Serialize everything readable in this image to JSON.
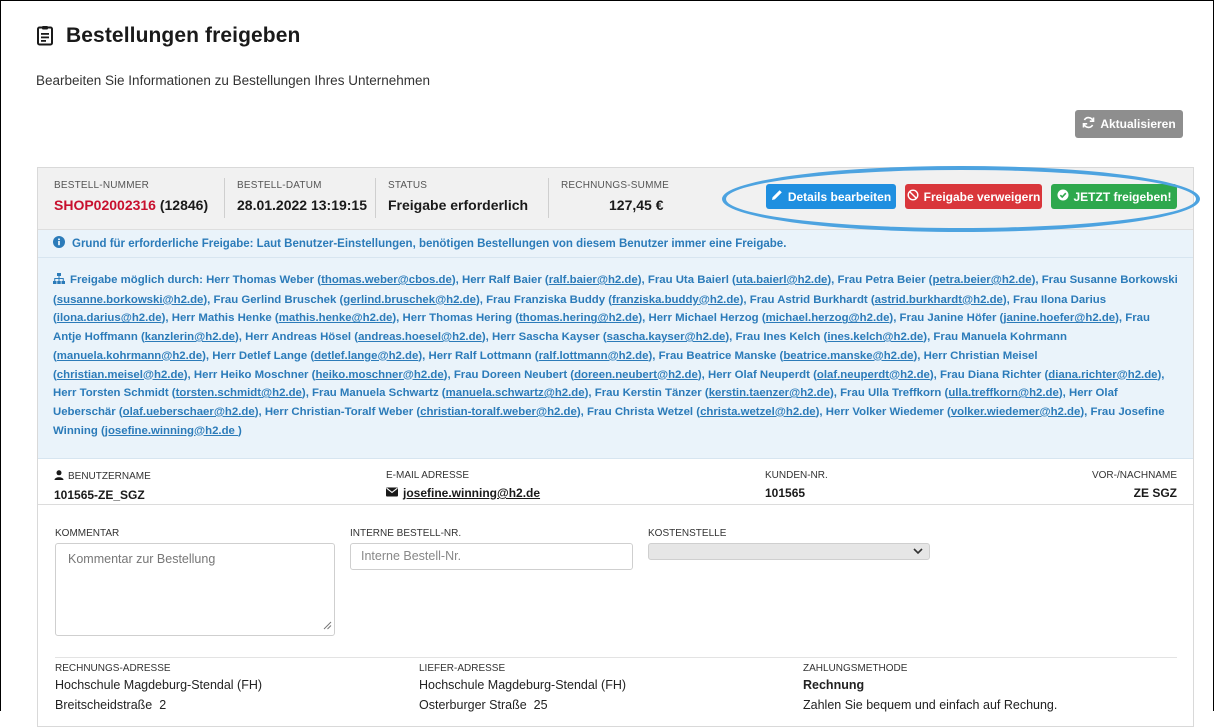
{
  "page": {
    "title": "Bestellungen freigeben",
    "subtitle": "Bearbeiten Sie Informationen zu Bestellungen Ihres Unternehmen",
    "refresh_label": "Aktualisieren"
  },
  "order": {
    "number_label": "BESTELL-NUMMER",
    "number": "SHOP02002316",
    "number_suffix": "(12846)",
    "date_label": "BESTELL-DATUM",
    "date": "28.01.2022 13:19:15",
    "status_label": "STATUS",
    "status": "Freigabe erforderlich",
    "sum_label": "RECHNUNGS-SUMME",
    "sum": "127,45 €"
  },
  "actions": {
    "edit": "Details bearbeiten",
    "deny": "Freigabe verweigern",
    "approve": "JETZT freigeben!"
  },
  "reason": "Grund für erforderliche Freigabe: Laut Benutzer-Einstellungen, benötigen Bestellungen von diesem Benutzer immer eine Freigabe.",
  "approvers": {
    "intro": "Freigabe möglich durch:",
    "people": [
      {
        "name": "Herr Thomas Weber",
        "email": "thomas.weber@cbos.de"
      },
      {
        "name": "Herr Ralf Baier",
        "email": "ralf.baier@h2.de"
      },
      {
        "name": "Frau Uta Baierl",
        "email": "uta.baierl@h2.de"
      },
      {
        "name": "Frau Petra Beier",
        "email": "petra.beier@h2.de"
      },
      {
        "name": "Frau Susanne Borkowski",
        "email": "susanne.borkowski@h2.de"
      },
      {
        "name": "Frau Gerlind Bruschek",
        "email": "gerlind.bruschek@h2.de"
      },
      {
        "name": "Frau Franziska Buddy",
        "email": "franziska.buddy@h2.de"
      },
      {
        "name": "Frau Astrid Burkhardt",
        "email": "astrid.burkhardt@h2.de"
      },
      {
        "name": "Frau Ilona Darius",
        "email": "ilona.darius@h2.de"
      },
      {
        "name": "Herr Mathis Henke",
        "email": "mathis.henke@h2.de"
      },
      {
        "name": "Herr Thomas Hering",
        "email": "thomas.hering@h2.de"
      },
      {
        "name": "Herr Michael Herzog",
        "email": "michael.herzog@h2.de"
      },
      {
        "name": "Frau Janine Höfer",
        "email": "janine.hoefer@h2.de"
      },
      {
        "name": "Frau Antje Hoffmann",
        "email": "kanzlerin@h2.de"
      },
      {
        "name": "Herr Andreas Hösel",
        "email": "andreas.hoesel@h2.de"
      },
      {
        "name": "Herr Sascha Kayser",
        "email": "sascha.kayser@h2.de"
      },
      {
        "name": "Frau Ines Kelch",
        "email": "ines.kelch@h2.de"
      },
      {
        "name": "Frau Manuela Kohrmann",
        "email": "manuela.kohrmann@h2.de"
      },
      {
        "name": "Herr Detlef Lange",
        "email": "detlef.lange@h2.de"
      },
      {
        "name": "Herr Ralf Lottmann",
        "email": "ralf.lottmann@h2.de"
      },
      {
        "name": "Frau Beatrice Manske",
        "email": "beatrice.manske@h2.de"
      },
      {
        "name": "Herr Christian Meisel",
        "email": "christian.meisel@h2.de"
      },
      {
        "name": "Herr Heiko Moschner",
        "email": "heiko.moschner@h2.de"
      },
      {
        "name": "Frau Doreen Neubert",
        "email": "doreen.neubert@h2.de"
      },
      {
        "name": "Herr Olaf Neuperdt",
        "email": "olaf.neuperdt@h2.de"
      },
      {
        "name": "Frau Diana Richter",
        "email": "diana.richter@h2.de"
      },
      {
        "name": "Herr Torsten Schmidt",
        "email": "torsten.schmidt@h2.de"
      },
      {
        "name": "Frau Manuela Schwartz",
        "email": "manuela.schwartz@h2.de"
      },
      {
        "name": "Frau Kerstin Tänzer",
        "email": "kerstin.taenzer@h2.de"
      },
      {
        "name": "Frau Ulla Treffkorn",
        "email": "ulla.treffkorn@h2.de"
      },
      {
        "name": "Herr Olaf Ueberschär",
        "email": "olaf.ueberschaer@h2.de"
      },
      {
        "name": "Herr Christian-Toralf Weber",
        "email": "christian-toralf.weber@h2.de"
      },
      {
        "name": "Frau Christa Wetzel",
        "email": "christa.wetzel@h2.de"
      },
      {
        "name": "Herr Volker Wiedemer",
        "email": "volker.wiedemer@h2.de"
      },
      {
        "name": "Frau Josefine Winning",
        "email": "josefine.winning@h2.de "
      }
    ]
  },
  "user": {
    "username_label": "BENUTZERNAME",
    "username": "101565-ZE_SGZ",
    "email_label": "E-MAIL ADRESSE",
    "email": "josefine.winning@h2.de",
    "customer_label": "KUNDEN-NR.",
    "customer": "101565",
    "name_label": "VOR-/NACHNAME",
    "name": "ZE SGZ"
  },
  "form": {
    "comment_label": "KOMMENTAR",
    "comment_placeholder": "Kommentar zur Bestellung",
    "internal_label": "INTERNE BESTELL-NR.",
    "internal_placeholder": "Interne Bestell-Nr.",
    "cost_label": "KOSTENSTELLE",
    "cost_value": ""
  },
  "addresses": {
    "billing_label": "RECHNUNGS-ADRESSE",
    "billing_line1": "Hochschule Magdeburg-Stendal (FH)",
    "billing_line2": "Breitscheidstraße  2",
    "delivery_label": "LIEFER-ADRESSE",
    "delivery_line1": "Hochschule Magdeburg-Stendal (FH)",
    "delivery_line2": "Osterburger Straße  25",
    "payment_label": "ZAHLUNGSMETHODE",
    "payment_method": "Rechnung",
    "payment_desc": "Zahlen Sie bequem und einfach auf Rechung."
  },
  "colors": {
    "order_number": "#c8102e",
    "info_blue": "#2b7bb9",
    "info_bg": "#eaf3fa",
    "btn_edit": "#1f8fe0",
    "btn_deny": "#d9363b",
    "btn_approve": "#2ea84d",
    "btn_refresh": "#8e8e8e",
    "highlight_ellipse": "#4da3e0"
  }
}
